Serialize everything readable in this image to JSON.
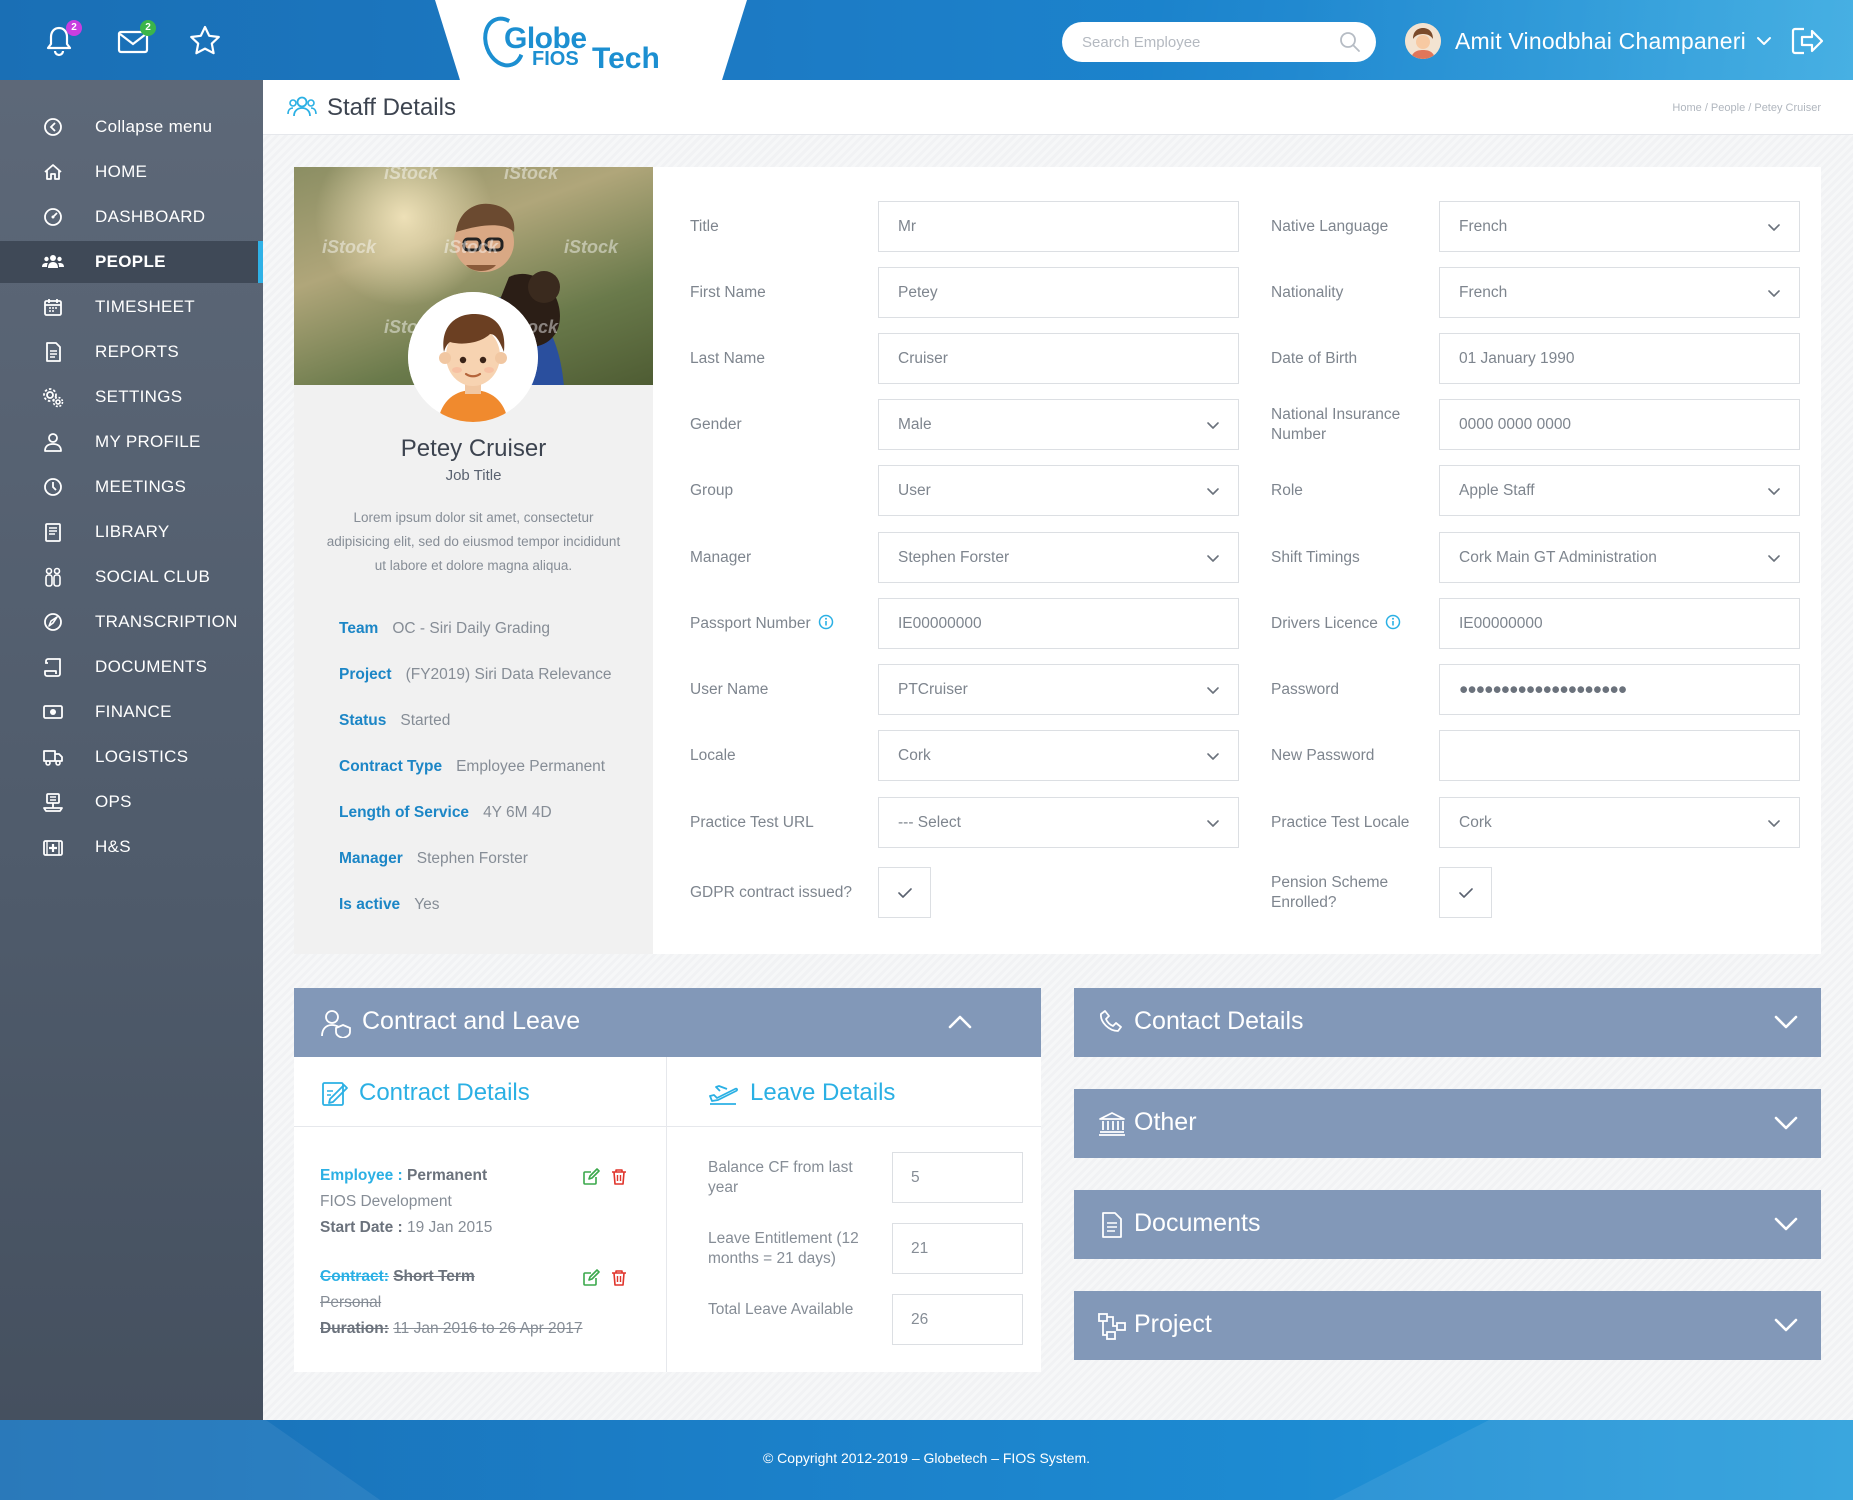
{
  "header": {
    "logo_line1": "Globe",
    "logo_line2": "FIOS",
    "logo_line3": "Tech",
    "notifications_count": "2",
    "messages_count": "2",
    "search_placeholder": "Search Employee",
    "user_name": "Amit Vinodbhai Champaneri"
  },
  "sidebar": {
    "items": [
      {
        "label": "Collapse menu",
        "icon": "collapse-icon"
      },
      {
        "label": "HOME",
        "icon": "home-icon"
      },
      {
        "label": "DASHBOARD",
        "icon": "dashboard-icon"
      },
      {
        "label": "PEOPLE",
        "icon": "people-icon",
        "active": true
      },
      {
        "label": "TIMESHEET",
        "icon": "calendar-icon"
      },
      {
        "label": "REPORTS",
        "icon": "report-icon"
      },
      {
        "label": "SETTINGS",
        "icon": "gears-icon"
      },
      {
        "label": "MY PROFILE",
        "icon": "user-icon"
      },
      {
        "label": "MEETINGS",
        "icon": "clock-icon"
      },
      {
        "label": "LIBRARY",
        "icon": "book-icon"
      },
      {
        "label": "SOCIAL CLUB",
        "icon": "social-icon"
      },
      {
        "label": "TRANSCRIPTION",
        "icon": "transcription-icon"
      },
      {
        "label": "DOCUMENTS",
        "icon": "scroll-icon"
      },
      {
        "label": "FINANCE",
        "icon": "money-icon"
      },
      {
        "label": "LOGISTICS",
        "icon": "truck-icon"
      },
      {
        "label": "OPS",
        "icon": "ops-icon"
      },
      {
        "label": "H&S",
        "icon": "medical-icon"
      }
    ]
  },
  "page": {
    "title": "Staff Details",
    "breadcrumb": "Home / People / Petey Cruiser"
  },
  "profile": {
    "watermark": "iStock",
    "name": "Petey Cruiser",
    "job_title": "Job Title",
    "description": "Lorem ipsum dolor sit amet, consectetur adipisicing elit, sed do eiusmod tempor incididunt ut labore et dolore magna aliqua.",
    "details": [
      {
        "key": "Team",
        "value": "OC - Siri Daily Grading"
      },
      {
        "key": "Project",
        "value": "(FY2019) Siri Data Relevance"
      },
      {
        "key": "Status",
        "value": "Started"
      },
      {
        "key": "Contract Type",
        "value": "Employee Permanent"
      },
      {
        "key": "Length of Service",
        "value": "4Y 6M 4D"
      },
      {
        "key": "Manager",
        "value": "Stephen Forster"
      },
      {
        "key": "Is active",
        "value": "Yes"
      }
    ]
  },
  "form": {
    "left": [
      {
        "label": "Title",
        "value": "Mr",
        "type": "text"
      },
      {
        "label": "First Name",
        "value": "Petey",
        "type": "text"
      },
      {
        "label": "Last Name",
        "value": "Cruiser",
        "type": "text"
      },
      {
        "label": "Gender",
        "value": "Male",
        "type": "select"
      },
      {
        "label": "Group",
        "value": "User",
        "type": "select"
      },
      {
        "label": "Manager",
        "value": "Stephen Forster",
        "type": "select"
      },
      {
        "label": "Passport Number",
        "value": "IE00000000",
        "type": "text",
        "info": true
      },
      {
        "label": "User Name",
        "value": "PTCruiser",
        "type": "select"
      },
      {
        "label": "Locale",
        "value": "Cork",
        "type": "select"
      },
      {
        "label": "Practice Test URL",
        "value": "--- Select",
        "type": "select"
      },
      {
        "label": "GDPR contract issued?",
        "value": "",
        "type": "checkbox",
        "checked": true
      }
    ],
    "right": [
      {
        "label": "Native Language",
        "value": "French",
        "type": "select"
      },
      {
        "label": "Nationality",
        "value": "French",
        "type": "select"
      },
      {
        "label": "Date of Birth",
        "value": "01 January 1990",
        "type": "text"
      },
      {
        "label": "National Insurance Number",
        "value": "0000 0000 0000",
        "type": "text"
      },
      {
        "label": "Role",
        "value": "Apple Staff",
        "type": "select"
      },
      {
        "label": "Shift Timings",
        "value": "Cork Main GT Administration",
        "type": "select"
      },
      {
        "label": "Drivers Licence",
        "value": "IE00000000",
        "type": "text",
        "info": true
      },
      {
        "label": "Password",
        "value": "●●●●●●●●●●●●●●●●●●●●",
        "type": "password"
      },
      {
        "label": "New Password",
        "value": "",
        "type": "text"
      },
      {
        "label": "Practice Test Locale",
        "value": "Cork",
        "type": "select"
      },
      {
        "label": "Pension Scheme Enrolled?",
        "value": "",
        "type": "checkbox",
        "checked": true
      }
    ]
  },
  "contract_leave": {
    "title": "Contract and Leave",
    "contract_title": "Contract Details",
    "leave_title": "Leave Details",
    "contracts": [
      {
        "type_key": "Employee :",
        "type_value": "Permanent",
        "company": "FIOS Development",
        "date_key": "Start Date :",
        "date_value": "19 Jan 2015",
        "struck": false
      },
      {
        "type_key": "Contract:",
        "type_value": "Short Term",
        "company": "Personal",
        "date_key": "Duration:",
        "date_value": "11 Jan 2016 to 26 Apr 2017",
        "struck": true
      }
    ],
    "leave": [
      {
        "label": "Balance CF from last year",
        "value": "5"
      },
      {
        "label": "Leave Entitlement (12 months = 21 days)",
        "value": "21"
      },
      {
        "label": "Total Leave Available",
        "value": "26"
      }
    ]
  },
  "accordions": [
    {
      "title": "Contact Details",
      "icon": "phone-icon"
    },
    {
      "title": "Other",
      "icon": "bank-icon"
    },
    {
      "title": "Documents",
      "icon": "document-icon"
    },
    {
      "title": "Project",
      "icon": "project-icon"
    }
  ],
  "footer": {
    "copyright": "© Copyright 2012-2019 – Globetech – FIOS System."
  },
  "colors": {
    "accent": "#2bb0e4",
    "key_blue": "#1c86c6",
    "panel_header": "#8298b8",
    "sidebar": "#4f5b6b",
    "edit_green": "#3aa84b",
    "delete_red": "#e0342b"
  }
}
